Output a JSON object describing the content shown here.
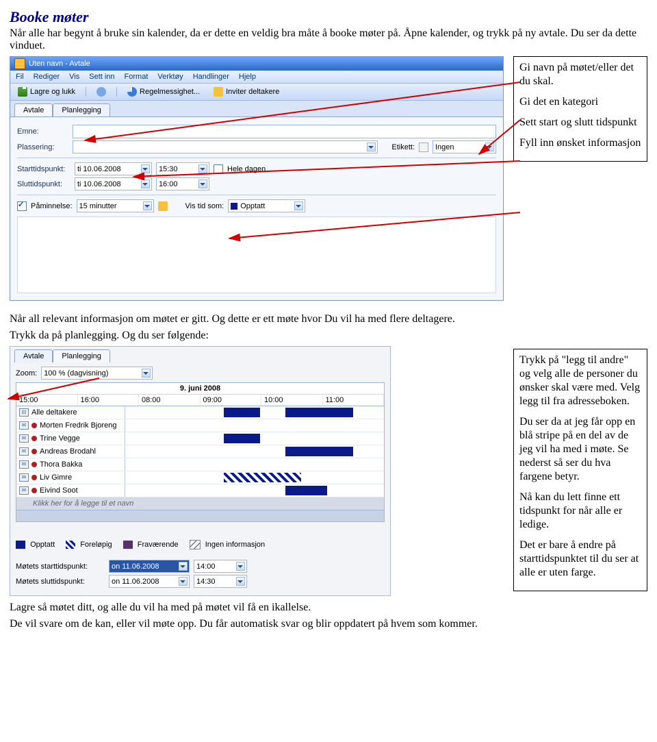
{
  "doc": {
    "title": "Booke møter",
    "intro": "Når alle har begynt å bruke sin kalender, da er dette en veldig bra måte å booke møter på. Åpne kalender, og trykk på ny avtale. Du ser da dette vinduet."
  },
  "sidebox1": {
    "p1": "Gi navn på møtet/eller det du skal.",
    "p2": "Gi det en kategori",
    "p3": "Sett start og slutt tidspunkt",
    "p4": "Fyll inn ønsket informasjon"
  },
  "win1": {
    "title": "Uten navn - Avtale",
    "menu": [
      "Fil",
      "Rediger",
      "Vis",
      "Sett inn",
      "Format",
      "Verktøy",
      "Handlinger",
      "Hjelp"
    ],
    "toolbar": {
      "save": "Lagre og lukk",
      "regelmessighet": "Regelmessighet...",
      "invite": "Inviter deltakere"
    },
    "tabs": [
      "Avtale",
      "Planlegging"
    ],
    "labels": {
      "emne": "Emne:",
      "plassering": "Plassering:",
      "etikett": "Etikett:",
      "etikett_val": "Ingen",
      "start": "Starttidspunkt:",
      "slutt": "Sluttidspunkt:",
      "date": "ti 10.06.2008",
      "t_start": "15:30",
      "t_slutt": "16:00",
      "heledagen": "Hele dagen",
      "paminnelse": "Påminnelse:",
      "pamin_val": "15 minutter",
      "vistid": "Vis tid som:",
      "vistid_val": "Opptatt"
    }
  },
  "mid": {
    "p1": "Når all relevant informasjon om møtet er gitt. Og dette er ett møte hvor Du vil ha med flere deltagere.",
    "p2": "Trykk da på planlegging. Og du ser følgende:"
  },
  "sidebox2": {
    "p1": "Trykk på \"legg til andre\" og velg alle de personer du ønsker skal være med. Velg legg til fra adresseboken.",
    "p2": "Du ser da at jeg får opp en blå stripe på en del av de jeg vil ha med i møte. Se nederst så ser du hva fargene betyr.",
    "p3": "Nå kan du lett finne ett tidspunkt for når alle er ledige.",
    "p4": "Det er bare å endre på starttidspunktet til du ser at alle er uten farge."
  },
  "win2": {
    "tabs": [
      "Avtale",
      "Planlegging"
    ],
    "zoom": {
      "label": "Zoom:",
      "value": "100 % (dagvisning)"
    },
    "date": "9. juni 2008",
    "times": [
      "15:00",
      "16:00",
      "08:00",
      "09:00",
      "10:00",
      "11:00"
    ],
    "people": [
      "Alle deltakere",
      "Morten Fredrik Bjoreng",
      "Trine Vegge",
      "Andreas Brodahl",
      "Thora Bakka",
      "Liv Gimre",
      "Eivind Soot"
    ],
    "addrow": "Klikk her for å legge til et navn",
    "legend": {
      "opp": "Opptatt",
      "for": "Foreløpig",
      "fra": "Fraværende",
      "ing": "Ingen informasjon"
    },
    "mstart": {
      "label": "Møtets starttidspunkt:",
      "date": "on 11.06.2008",
      "time": "14:00"
    },
    "mslutt": {
      "label": "Møtets sluttidspunkt:",
      "date": "on 11.06.2008",
      "time": "14:30"
    }
  },
  "tail": {
    "p1": "Lagre så møtet ditt, og alle du vil ha med på møtet vil få en ikallelse.",
    "p2": "De vil svare om de kan, eller vil møte opp. Du får automatisk svar og blir oppdatert på hvem som kommer."
  }
}
